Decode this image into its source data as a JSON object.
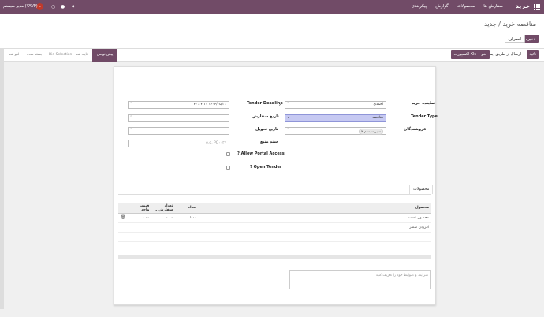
{
  "navbar": {
    "brand": "خرید",
    "menu": [
      "سفارش ها",
      "محصولات",
      "گزارش",
      "پیکربندی"
    ],
    "user": "مدیر سیستم (YAVP)",
    "avatar_letter": "م",
    "icons": [
      "bell-icon",
      "chat-icon",
      "clock-icon"
    ]
  },
  "control": {
    "breadcrumb": "مناقصه خرید / جدید",
    "save_label": "ذخیره",
    "discard_label": "انصراف"
  },
  "actions": {
    "confirm": "تائید",
    "send_email": "ارسال از طریق ایمیل",
    "cancel": "لغو",
    "export_xls": "اکسپورت Xls"
  },
  "statusbar": [
    "پیش نویس",
    "تایید شد",
    "Bid Selection",
    "بسته شده",
    "لغو شد"
  ],
  "form": {
    "purchase_rep_label": "نماینده خرید",
    "purchase_rep_value": "احمدی",
    "tender_type_label": "Tender Type",
    "tender_type_value": "مناقصه",
    "vendors_label": "فروشندگان",
    "vendor_tag": "مدیر سیستم",
    "tender_deadline_label": "Tender Deadline",
    "tender_deadline_value": "۱۴۰۴/۰۵/۳۱ ۲۰:۳۲:۱۱",
    "order_date_label": "تاریخ سفارش",
    "delivery_date_label": "تاریخ تحویل",
    "source_doc_label": "سند منبع",
    "source_doc_placeholder": "e.g. PO۰۰۳۲",
    "allow_portal_label": "Allow Portal Access ?",
    "open_tender_label": "Open Tender ?"
  },
  "tabs": {
    "products": "محصولات"
  },
  "lines": {
    "headers": [
      "محصول",
      "تعداد",
      "تعداد سفارش...",
      "قیمت واحد"
    ],
    "rows": [
      {
        "product": "محصول تست",
        "qty": "۱.۰۰",
        "ordered": "۰.۰۰",
        "price": "۰.۰۰"
      }
    ],
    "add_line": "افزودن سطر"
  },
  "notes_placeholder": "شرایط و ضوابط خود را تعریف کنید",
  "colors": {
    "brand": "#714b67",
    "highlight": "#c6c9f2"
  }
}
